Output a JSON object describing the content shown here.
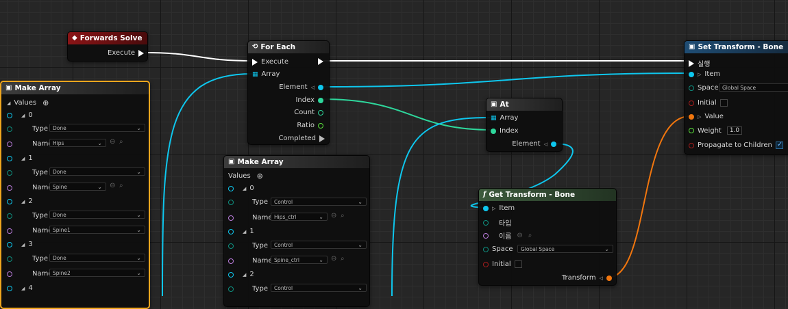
{
  "forwards_solve": {
    "title": "Forwards Solve",
    "execute": "Execute"
  },
  "for_each": {
    "title": "For Each",
    "execute": "Execute",
    "array": "Array",
    "element": "Element",
    "index": "Index",
    "count": "Count",
    "ratio": "Ratio",
    "completed": "Completed"
  },
  "at": {
    "title": "At",
    "array": "Array",
    "index": "Index",
    "element": "Element"
  },
  "set_transform": {
    "title": "Set Transform - Bone",
    "execute": "실행",
    "item": "Item",
    "space": "Space",
    "space_value": "Global Space",
    "initial": "Initial",
    "value": "Value",
    "weight": "Weight",
    "weight_value": "1.0",
    "propagate": "Propagate to Children"
  },
  "get_transform": {
    "title": "Get Transform - Bone",
    "item": "Item",
    "type": "타입",
    "name": "이름",
    "space": "Space",
    "space_value": "Global Space",
    "initial": "Initial",
    "transform": "Transform"
  },
  "make_array_1": {
    "title": "Make Array",
    "values": "Values",
    "entries": [
      {
        "index": "0",
        "type_label": "Type",
        "type": "Done",
        "name_label": "Name",
        "name": "Hips"
      },
      {
        "index": "1",
        "type_label": "Type",
        "type": "Done",
        "name_label": "Name",
        "name": "Spine"
      },
      {
        "index": "2",
        "type_label": "Type",
        "type": "Done",
        "name_label": "Name",
        "name": "Spine1"
      },
      {
        "index": "3",
        "type_label": "Type",
        "type": "Done",
        "name_label": "Name",
        "name": "Spine2"
      },
      {
        "index": "4"
      }
    ]
  },
  "make_array_2": {
    "title": "Make Array",
    "values": "Values",
    "entries": [
      {
        "index": "0",
        "type_label": "Type",
        "type": "Control",
        "name_label": "Name",
        "name": "Hips_ctrl"
      },
      {
        "index": "1",
        "type_label": "Type",
        "type": "Control",
        "name_label": "Name",
        "name": "Spine_ctrl"
      },
      {
        "index": "2",
        "type_label": "Type",
        "type": "Control"
      }
    ]
  },
  "colors": {
    "exec": "#ffffff",
    "struct": "#0ec7ee",
    "int": "#2ed79c",
    "bool": "#a51c1c",
    "transform": "#f1760e",
    "float": "#5be23c",
    "name": "#b77ad8",
    "selection": "#f0a61e"
  },
  "icons": {
    "forwards_solve": "diamond-event-icon",
    "for_each": "loop-icon",
    "make_array": "array-node-icon",
    "set_transform": "function-node-icon",
    "get_transform": "f-function-icon",
    "add": "plus-circle-icon",
    "browse": "arrow-left-icon",
    "search": "magnifier-icon"
  }
}
